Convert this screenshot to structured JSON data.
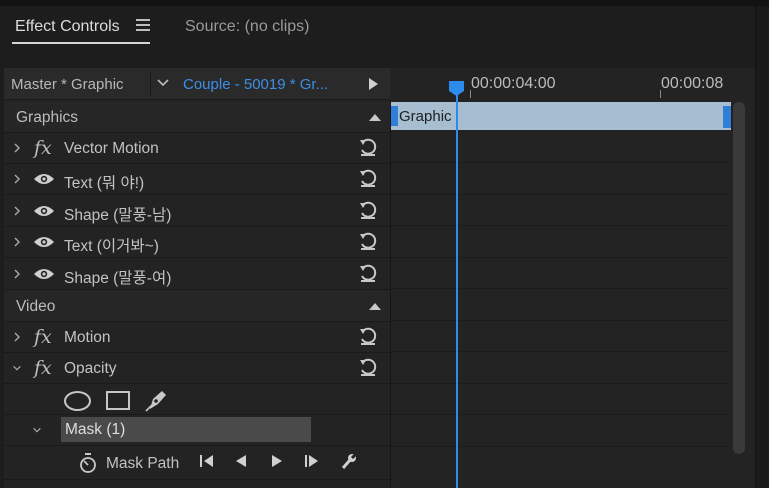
{
  "panel": {
    "tabs": [
      {
        "label": "Effect Controls"
      },
      {
        "label": "Source: (no clips)"
      }
    ]
  },
  "header": {
    "master_label": "Master * Graphic",
    "clip_label": "Couple - 50019 * Gr..."
  },
  "timeline": {
    "timecodes": [
      "00:00:04:00",
      "00:00:08"
    ],
    "clip_name": "Graphic"
  },
  "sections": {
    "graphics": "Graphics",
    "video": "Video"
  },
  "graphics_items": [
    {
      "label": "Vector Motion",
      "icon": "fx"
    },
    {
      "label": "Text (뭐 야!)",
      "icon": "eye"
    },
    {
      "label": "Shape (말풍-남)",
      "icon": "eye"
    },
    {
      "label": "Text (이거봐~)",
      "icon": "eye"
    },
    {
      "label": "Shape (말풍-여)",
      "icon": "eye"
    }
  ],
  "video_items": [
    {
      "label": "Motion",
      "icon": "fx"
    },
    {
      "label": "Opacity",
      "icon": "fx",
      "expanded": true
    }
  ],
  "mask": {
    "label": "Mask (1)",
    "path_label": "Mask Path",
    "tools": [
      "ellipse-mask-icon",
      "rectangle-mask-icon",
      "pen-mask-icon"
    ]
  },
  "colors": {
    "accent": "#2d8ceb",
    "clip_bar": "#a7bed0",
    "link_blue": "#3c8fe6"
  }
}
